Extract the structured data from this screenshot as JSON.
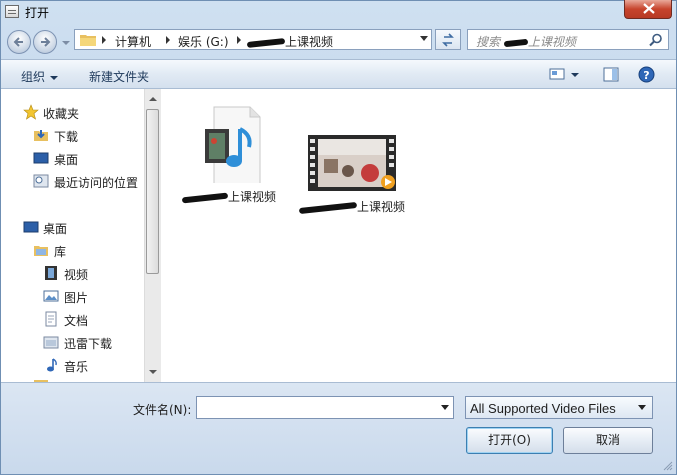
{
  "window": {
    "title": "打开"
  },
  "address": {
    "crumbs": [
      "计算机",
      "娱乐 (G:)",
      "上课视频"
    ],
    "search_placeholder": "搜索",
    "search_suffix": "上课视频"
  },
  "toolbar": {
    "organize": "组织",
    "new_folder": "新建文件夹"
  },
  "navpane": {
    "favorites": "收藏夹",
    "downloads": "下载",
    "desktop": "桌面",
    "recent": "最近访问的位置",
    "desktop2": "桌面",
    "libraries": "库",
    "videos": "视频",
    "pictures": "图片",
    "documents": "文档",
    "thunder": "迅雷下载",
    "music": "音乐"
  },
  "files": [
    {
      "label": "上课视频",
      "kind": "folder-video-music"
    },
    {
      "label": "上课视频",
      "kind": "video-file"
    }
  ],
  "bottom": {
    "filename_label": "文件名(N):",
    "filename_value": "",
    "filetype": "All Supported Video Files",
    "open_label": "打开(O)",
    "cancel_label": "取消"
  },
  "colors": {
    "accent": "#3c7fb1",
    "close": "#c7442d"
  }
}
